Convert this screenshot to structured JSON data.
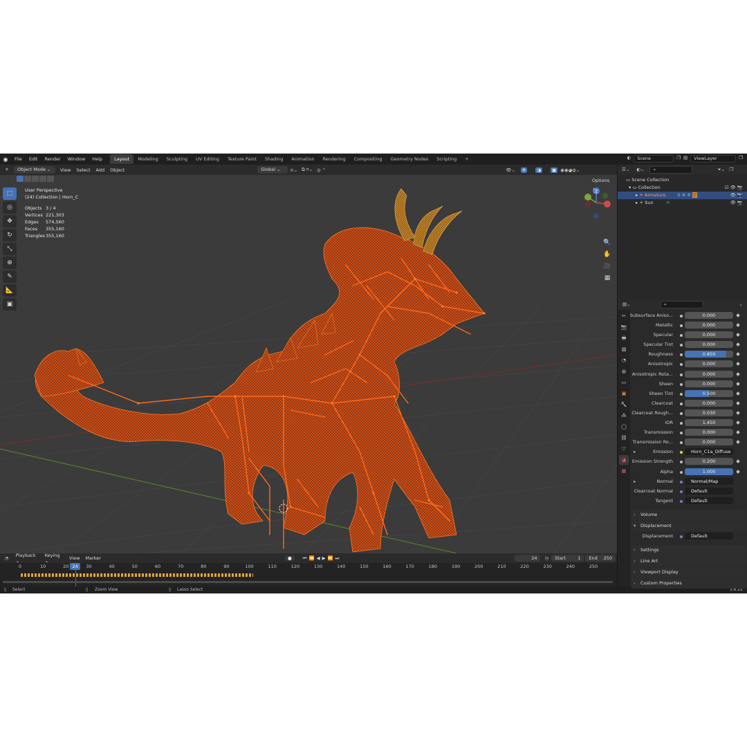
{
  "menu": [
    "File",
    "Edit",
    "Render",
    "Window",
    "Help"
  ],
  "workspaces": [
    "Layout",
    "Modeling",
    "Sculpting",
    "UV Editing",
    "Texture Paint",
    "Shading",
    "Animation",
    "Rendering",
    "Compositing",
    "Geometry Nodes",
    "Scripting",
    "+"
  ],
  "active_workspace": "Layout",
  "scene_field": "Scene",
  "viewlayer_field": "ViewLayer",
  "viewport_header": {
    "mode": "Object Mode",
    "items": [
      "View",
      "Select",
      "Add",
      "Object"
    ],
    "orientation": "Global",
    "options": "Options"
  },
  "overlay": {
    "perspective": "User Perspective",
    "collection": "(24) Collection | Horn_C",
    "stats": [
      {
        "label": "Objects",
        "value": "3 / 4"
      },
      {
        "label": "Vertices",
        "value": "221,303"
      },
      {
        "label": "Edges",
        "value": "574,560"
      },
      {
        "label": "Faces",
        "value": "355,160"
      },
      {
        "label": "Triangles",
        "value": "355,160"
      }
    ]
  },
  "outliner": {
    "root": "Scene Collection",
    "collection": "Collection",
    "items": [
      {
        "name": "Armature",
        "selected": true
      },
      {
        "name": "Sun",
        "selected": false
      }
    ]
  },
  "properties": {
    "rows": [
      {
        "label": "Subsurface Aniso...",
        "value": "0.000",
        "fraction": 0
      },
      {
        "label": "Metallic",
        "value": "0.000",
        "fraction": 0
      },
      {
        "label": "Specular",
        "value": "0.000",
        "fraction": 0
      },
      {
        "label": "Specular Tint",
        "value": "0.000",
        "fraction": 0
      },
      {
        "label": "Roughness",
        "value": "0.859",
        "fraction": 0.859
      },
      {
        "label": "Anisotropic",
        "value": "0.000",
        "fraction": 0
      },
      {
        "label": "Anisotropic Rota...",
        "value": "0.000",
        "fraction": 0
      },
      {
        "label": "Sheen",
        "value": "0.000",
        "fraction": 0
      },
      {
        "label": "Sheen Tint",
        "value": "0.500",
        "fraction": 0.5
      },
      {
        "label": "Clearcoat",
        "value": "0.000",
        "fraction": 0
      },
      {
        "label": "Clearcoat Rough...",
        "value": "0.030",
        "fraction": 0
      },
      {
        "label": "IOR",
        "value": "1.450",
        "fraction": 0
      },
      {
        "label": "Transmission",
        "value": "0.000",
        "fraction": 0
      },
      {
        "label": "Transmission Ro...",
        "value": "0.000",
        "fraction": 0
      },
      {
        "label": "Emission",
        "value": "Horn_C1a_Diffuse",
        "link": true,
        "expand": true
      },
      {
        "label": "Emission Strength",
        "value": "0.200",
        "fraction": 0
      },
      {
        "label": "Alpha",
        "value": "1.000",
        "fraction": 1
      },
      {
        "label": "Normal",
        "value": "Normal/Map",
        "link": true,
        "expand": true
      },
      {
        "label": "Clearcoat Normal",
        "value": "Default",
        "link": true
      },
      {
        "label": "Tangent",
        "value": "Default",
        "link": true
      }
    ],
    "panels_top": [
      {
        "label": "Volume",
        "open": false
      },
      {
        "label": "Displacement",
        "open": true
      }
    ],
    "displacement_row": {
      "label": "Displacement",
      "value": "Default"
    },
    "panels_bottom": [
      {
        "label": "Settings"
      },
      {
        "label": "Line Art"
      },
      {
        "label": "Viewport Display"
      },
      {
        "label": "Custom Properties"
      }
    ]
  },
  "timeline": {
    "menus": [
      "Playback",
      "Keying",
      "View",
      "Marker"
    ],
    "current_frame": "24",
    "start_label": "Start",
    "start": "1",
    "end_label": "End",
    "end": "250",
    "ruler": [
      "0",
      "10",
      "20",
      "24",
      "30",
      "40",
      "50",
      "60",
      "70",
      "80",
      "90",
      "100",
      "110",
      "120",
      "130",
      "140",
      "150",
      "160",
      "170",
      "180",
      "190",
      "200",
      "210",
      "220",
      "230",
      "240",
      "250"
    ]
  },
  "statusbar": {
    "select": "Select",
    "zoom": "Zoom View",
    "lasso": "Lasso Select",
    "version": "3.6.22"
  },
  "colors": {
    "selection_orange": "#ff6a1a",
    "accent_blue": "#4772b3",
    "horn_yellow": "#d9922a"
  }
}
